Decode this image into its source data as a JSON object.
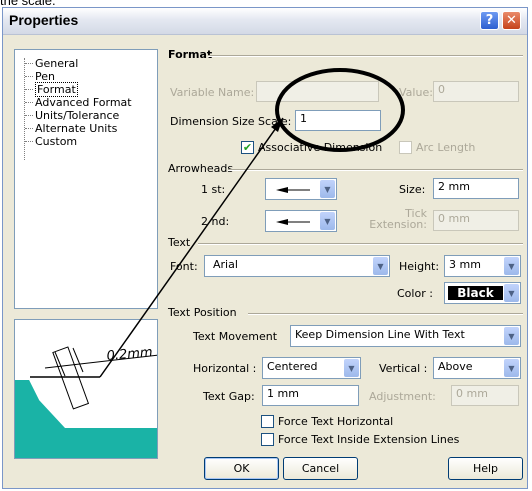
{
  "top_caption": "the scale.",
  "dialog": {
    "title": "Properties",
    "help_glyph": "?",
    "close_glyph": "✕"
  },
  "tree": {
    "items": [
      "General",
      "Pen",
      "Format",
      "Advanced Format",
      "Units/Tolerance",
      "Alternate Units",
      "Custom"
    ],
    "selected": "Format"
  },
  "preview": {
    "dimension_text": "0.2mm"
  },
  "format": {
    "section_title": "Format",
    "variable_name_label": "Variable Name:",
    "variable_name_value": "",
    "value_label": "Value:",
    "value_value": "0",
    "dimension_size_scale_label": "Dimension Size Scale:",
    "dimension_size_scale_value": "1",
    "associative_dimension_label": "Associative Dimension",
    "associative_dimension_checked": true,
    "arc_length_label": "Arc Length",
    "arc_length_checked": false
  },
  "arrowheads": {
    "section_title": "Arrowheads",
    "first_label": "1 st:",
    "second_label": "2 nd:",
    "size_label": "Size:",
    "size_value": "2 mm",
    "tick_extension_label": "Tick Extension:",
    "tick_extension_value": "0 mm"
  },
  "text": {
    "section_title": "Text",
    "font_label": "Font:",
    "font_value": "Arial",
    "height_label": "Height:",
    "height_value": "3 mm",
    "color_label": "Color :",
    "color_value": "Black",
    "color_hex": "#000000"
  },
  "text_position": {
    "section_title": "Text Position",
    "text_movement_label": "Text Movement",
    "text_movement_value": "Keep Dimension Line With Text",
    "horizontal_label": "Horizontal :",
    "horizontal_value": "Centered",
    "vertical_label": "Vertical :",
    "vertical_value": "Above",
    "text_gap_label": "Text Gap:",
    "text_gap_value": "1 mm",
    "adjustment_label": "Adjustment:",
    "adjustment_value": "0 mm",
    "force_horizontal_label": "Force Text Horizontal",
    "force_horizontal_checked": false,
    "force_inside_label": "Force Text Inside Extension Lines",
    "force_inside_checked": false
  },
  "buttons": {
    "ok": "OK",
    "cancel": "Cancel",
    "help": "Help"
  },
  "colors": {
    "teal_fill": "#1ab3a6",
    "annotation": "#000000"
  }
}
